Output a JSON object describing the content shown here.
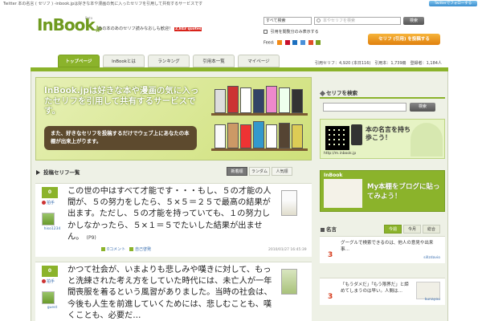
{
  "topbar": {
    "text": "Twitter 本の名言 ( セリフ ) -inbook.jpは好きな本や漫画の気に入ったセリフを引用して共有するサービスです",
    "twitter_badge": "Twitterでフォローする"
  },
  "logo": {
    "word": "InBook",
    "suffix": ".jp",
    "beta": "Beta"
  },
  "tagline": {
    "text": "あの本のあのセリフ読みなおしも歓迎！",
    "hot": "2,843 quotes"
  },
  "search": {
    "select_value": "すべて検索",
    "placeholder": "本やセリフを検索",
    "button": "検索",
    "checkbox_label": "引用を閲覧分のみ表示する"
  },
  "feeds": {
    "label": "Feed:",
    "icons": [
      "rss-icon",
      "yahoo-icon",
      "hatena-icon",
      "google-icon",
      "live-icon",
      "bloglines-icon"
    ]
  },
  "register_button": "セリフ (引用) を投稿する",
  "nav": {
    "tabs": [
      "トップページ",
      "InBookとは",
      "ランキング",
      "引用本一覧",
      "マイページ"
    ]
  },
  "stats": {
    "text": "引用セリフ：4,920 (本日116)　引用本：1,739冊　登録者：1,184人"
  },
  "banner": {
    "headline": "InBook.jpは好きな本や漫画の気に入ったセリフを引用して共有するサービスです。",
    "bubble": "また、好きなセリフを投稿するだけでウェブ上にあなたの本棚が出来上がります。"
  },
  "side_search": {
    "title": "セリフを検索",
    "button": "検索"
  },
  "qr": {
    "text": "本の名言を持ち歩こう！",
    "url": "http://m.inbook.jp"
  },
  "inbook_blog": {
    "label": "InBook",
    "message": "My本棚をブログに貼ってみよう！"
  },
  "quotes_side": {
    "title": "名言",
    "tabs": [
      "今週",
      "今月",
      "総合"
    ],
    "items": [
      {
        "num": "3",
        "text": "グーグルで検索できるのは、他人の意見や出来事…",
        "by": "sillzdavio"
      },
      {
        "num": "3",
        "text": "「もうダメだ」「もう限界だ」と諦めてしまうのは早い。人間は…",
        "by": "kunayou"
      }
    ]
  },
  "posts": {
    "title": "投稿セリフ一覧",
    "tabs": [
      "新着順",
      "ランダム",
      "人気順"
    ],
    "items": [
      {
        "count": "0",
        "like": "拍手",
        "user": "hiso1234",
        "text": "この世の中はすべて才能です・・・もし、５の才能の人間が、５の努力をしたら、５×５＝２５で最高の結果が出ます。ただし、５の才能を持っていても、１の努力しかしなかったら、５×１＝５でたいした結果が出ません。",
        "page": "(P9)",
        "comment": "0コメント",
        "tag": "自己啓発",
        "date": "2010/01/27 16:45:39"
      },
      {
        "count": "0",
        "like": "拍手",
        "user": "guest",
        "text": "かつて社会が、いまよりも悲しみや嘆きに対して、もっと洗練された考え方をしていた時代には、未亡人が一年間喪服を着るという風習がありました。当時の社会は、今後も人生を前進していくためには、悲しむことも、嘆くことも、必要だ…",
        "page": "",
        "comment": "",
        "tag": "",
        "date": ""
      }
    ]
  }
}
